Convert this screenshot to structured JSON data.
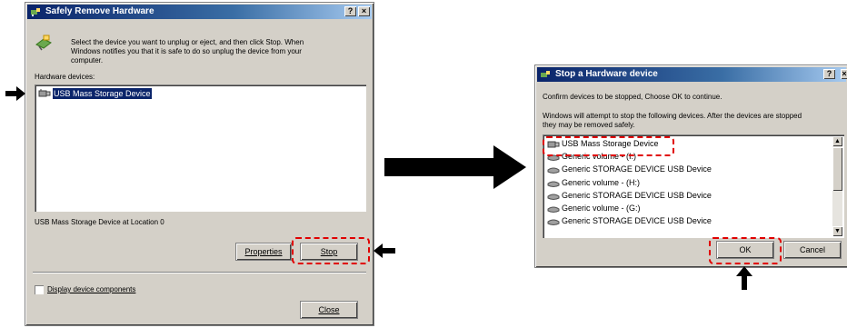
{
  "dialog1": {
    "title": "Safely Remove Hardware",
    "help_label": "?",
    "close_label": "×",
    "instructions": [
      "Select the device you want to unplug or eject, and then click Stop. When",
      "Windows notifies you that it is safe to do so unplug the device from your",
      "computer."
    ],
    "hardware_label": "Hardware devices:",
    "devices": [
      "USB Mass Storage Device"
    ],
    "location_text": "USB Mass Storage Device at Location 0",
    "properties_label": "Properties",
    "stop_label": "Stop",
    "checkbox_label": "Display device components",
    "checkbox_checked": false,
    "close_button_label": "Close"
  },
  "dialog2": {
    "title": "Stop a Hardware device",
    "help_label": "?",
    "close_label": "×",
    "confirm_text": "Confirm devices to be stopped, Choose OK to continue.",
    "info_text": [
      "Windows will attempt to stop the following devices. After the devices are stopped",
      "they may be removed safely."
    ],
    "devices": [
      {
        "label": "USB Mass Storage Device",
        "icon": "usb-icon"
      },
      {
        "label": "Generic volume - (I:)",
        "icon": "drive-icon"
      },
      {
        "label": "Generic STORAGE DEVICE USB Device",
        "icon": "drive-icon"
      },
      {
        "label": "Generic volume - (H:)",
        "icon": "drive-icon"
      },
      {
        "label": "Generic STORAGE DEVICE USB Device",
        "icon": "drive-icon"
      },
      {
        "label": "Generic volume - (G:)",
        "icon": "drive-icon"
      },
      {
        "label": "Generic STORAGE DEVICE USB Device",
        "icon": "drive-icon"
      }
    ],
    "ok_label": "OK",
    "cancel_label": "Cancel"
  },
  "colors": {
    "highlight": "#e00000",
    "selection": "#0a246a",
    "title_start": "#0a246a"
  }
}
